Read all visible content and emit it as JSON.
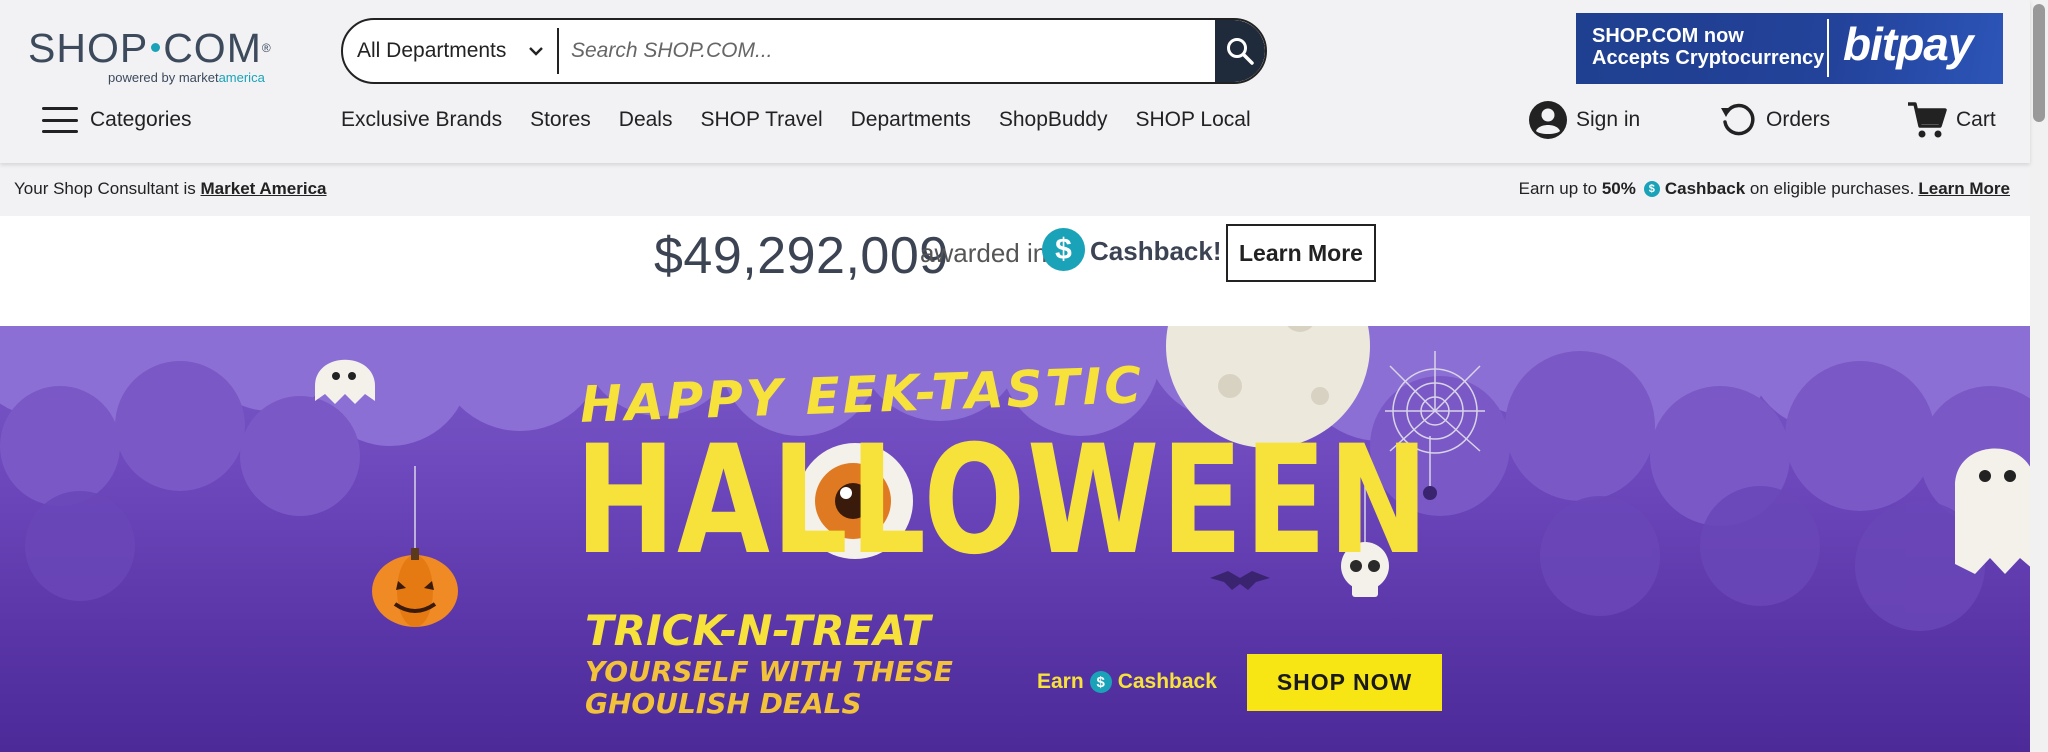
{
  "logo": {
    "brand_left": "SHOP",
    "brand_right": "COM",
    "reg": "®",
    "sub_prefix": "powered by market",
    "sub_suffix": "america"
  },
  "search": {
    "department": "All Departments",
    "placeholder": "Search SHOP.COM..."
  },
  "ad": {
    "line1": "SHOP.COM now",
    "line2": "Accepts Cryptocurrency",
    "logo": "bitpay"
  },
  "nav": {
    "categories": "Categories",
    "links": [
      "Exclusive Brands",
      "Stores",
      "Deals",
      "SHOP Travel",
      "Departments",
      "ShopBuddy",
      "SHOP Local"
    ],
    "sign_in": "Sign in",
    "orders": "Orders",
    "cart": "Cart"
  },
  "infobar": {
    "consultant_prefix": "Your Shop Consultant is",
    "consultant_name": "Market America",
    "earn_prefix": "Earn up to",
    "earn_percent": "50%",
    "cashback": "Cashback",
    "earn_suffix": "on eligible purchases.",
    "learn_more": "Learn More"
  },
  "cashstrip": {
    "amount": "$49,292,009",
    "awarded": "awarded in",
    "cashback": "Cashback!",
    "learn_more": "Learn More"
  },
  "banner": {
    "happy": "HAPPY EEK-TASTIC",
    "halloween": "HALLOWEEN",
    "trick": "TRICK-N-TREAT",
    "line1": "YOURSELF WITH THESE",
    "line2": "GHOULISH DEALS",
    "earn": "Earn",
    "cashback": "Cashback",
    "shop_now": "SHOP NOW"
  },
  "colors": {
    "accent": "#1aa3b8",
    "banner_purple": "#6d48bd",
    "banner_yellow": "#f7e23b",
    "header_bg": "#f2f2f5"
  }
}
